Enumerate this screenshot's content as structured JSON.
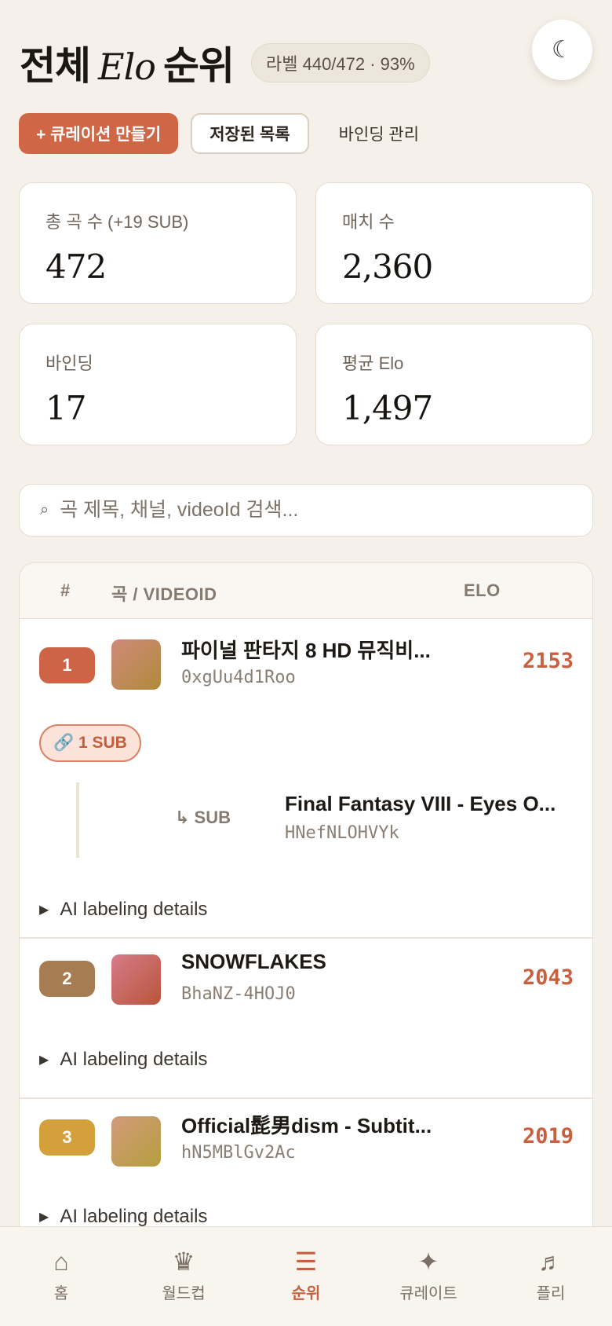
{
  "header": {
    "title_prefix": "전체",
    "title_elo": "Elo",
    "title_suffix": "순위",
    "label_badge": "라벨 440/472 · 93%",
    "theme_icon": "☾"
  },
  "actions": {
    "create_curation": "+ 큐레이션 만들기",
    "saved_list": "저장된 목록",
    "binding_manage": "바인딩 관리"
  },
  "stats": [
    {
      "label": "총 곡 수 (+19 SUB)",
      "value": "472"
    },
    {
      "label": "매치 수",
      "value": "2,360"
    },
    {
      "label": "바인딩",
      "value": "17"
    },
    {
      "label": "평균 Elo",
      "value": "1,497"
    }
  ],
  "search": {
    "icon": "⌕",
    "placeholder": "곡 제목, 채널, videoId 검색..."
  },
  "table": {
    "headers": {
      "rank": "#",
      "song": "곡 / VIDEOID",
      "elo": "ELO"
    },
    "rows": [
      {
        "rank": "1",
        "title": "파이널 판타지 8 HD 뮤직비...",
        "video_id": "0xgUu4d1Roo",
        "elo": "2153",
        "sub_badge": "🔗 1 SUB",
        "sub": {
          "tag": "↳ SUB",
          "title": "Final Fantasy VIII - Eyes O...",
          "video_id": "HNefNLOHVYk"
        },
        "details": "AI labeling details",
        "rank_color": "#cd6446",
        "thumb_colors": [
          "#cf8a7a",
          "#b08a3a"
        ]
      },
      {
        "rank": "2",
        "title": "SNOWFLAKES",
        "video_id": "BhaNZ-4HOJ0",
        "elo": "2043",
        "details": "AI labeling details",
        "rank_color": "#a67c52",
        "thumb_colors": [
          "#d67b8a",
          "#b8553a"
        ]
      },
      {
        "rank": "3",
        "title": "Official髭男dism - Subtit...",
        "video_id": "hN5MBlGv2Ac",
        "elo": "2019",
        "details": "AI labeling details",
        "rank_color": "#d4a03c",
        "thumb_colors": [
          "#d49a7c",
          "#b49e3e"
        ]
      }
    ]
  },
  "nav": [
    {
      "icon": "⌂",
      "label": "홈",
      "active": false
    },
    {
      "icon": "♛",
      "label": "월드컵",
      "active": false
    },
    {
      "icon": "☰",
      "label": "순위",
      "active": true
    },
    {
      "icon": "✦",
      "label": "큐레이트",
      "active": false
    },
    {
      "icon": "♬",
      "label": "플리",
      "active": false
    }
  ]
}
